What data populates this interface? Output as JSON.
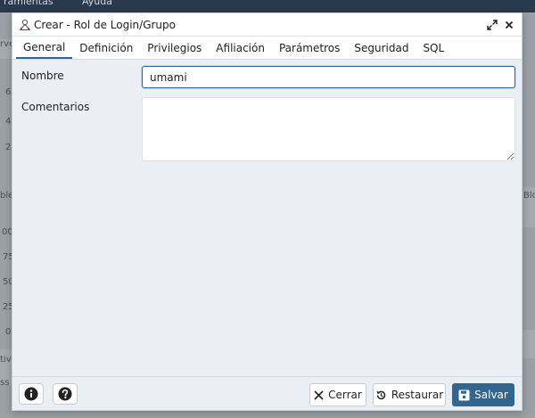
{
  "background": {
    "menus": [
      "ramientas",
      "Ayuda"
    ],
    "fragments": [
      "rve",
      "6",
      "4",
      "2",
      "ble",
      "Blo",
      "00",
      "75",
      "50",
      "25",
      "0",
      "tiv",
      "ss"
    ]
  },
  "dialog": {
    "title": "Crear - Rol de Login/Grupo",
    "tabs": [
      {
        "label": "General",
        "active": true
      },
      {
        "label": "Definición",
        "active": false
      },
      {
        "label": "Privilegios",
        "active": false
      },
      {
        "label": "Afiliación",
        "active": false
      },
      {
        "label": "Parámetros",
        "active": false
      },
      {
        "label": "Seguridad",
        "active": false
      },
      {
        "label": "SQL",
        "active": false
      }
    ],
    "form": {
      "name_label": "Nombre",
      "name_value": "umami",
      "comments_label": "Comentarios",
      "comments_value": ""
    },
    "footer": {
      "close_label": "Cerrar",
      "reset_label": "Restaurar",
      "save_label": "Salvar"
    }
  },
  "colors": {
    "primary": "#326690",
    "dialog_bg": "#ebeef3"
  }
}
